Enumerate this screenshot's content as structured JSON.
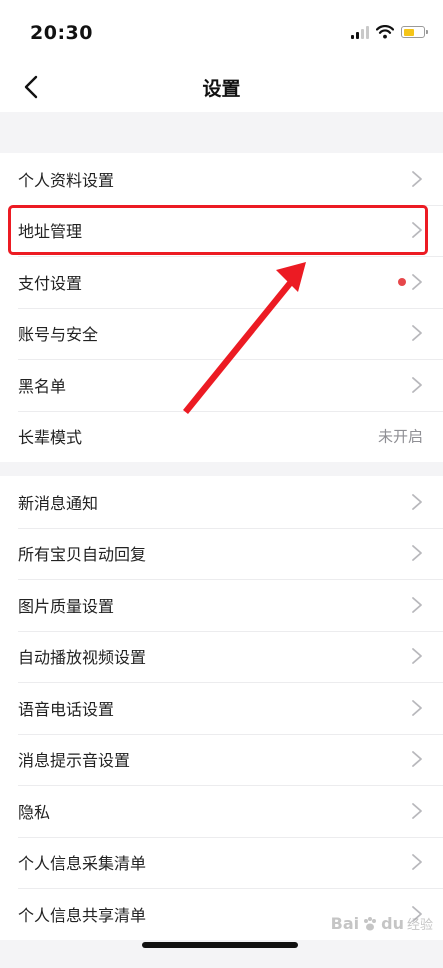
{
  "status_bar": {
    "time": "20:30"
  },
  "nav": {
    "title": "设置"
  },
  "group1": {
    "items": [
      {
        "label": "个人资料设置"
      },
      {
        "label": "地址管理"
      },
      {
        "label": "支付设置"
      },
      {
        "label": "账号与安全"
      },
      {
        "label": "黑名单"
      },
      {
        "label": "长辈模式",
        "value": "未开启"
      }
    ]
  },
  "group2": {
    "items": [
      {
        "label": "新消息通知"
      },
      {
        "label": "所有宝贝自动回复"
      },
      {
        "label": "图片质量设置"
      },
      {
        "label": "自动播放视频设置"
      },
      {
        "label": "语音电话设置"
      },
      {
        "label": "消息提示音设置"
      },
      {
        "label": "隐私"
      },
      {
        "label": "个人信息采集清单"
      },
      {
        "label": "个人信息共享清单"
      }
    ]
  },
  "watermark": {
    "brand": "Bai",
    "brand_suffix": "du",
    "sub": "经验"
  },
  "colors": {
    "highlight": "#ec1b23",
    "badge": "#e6474a",
    "battery": "#f5c518"
  },
  "battery_level": 0.55
}
